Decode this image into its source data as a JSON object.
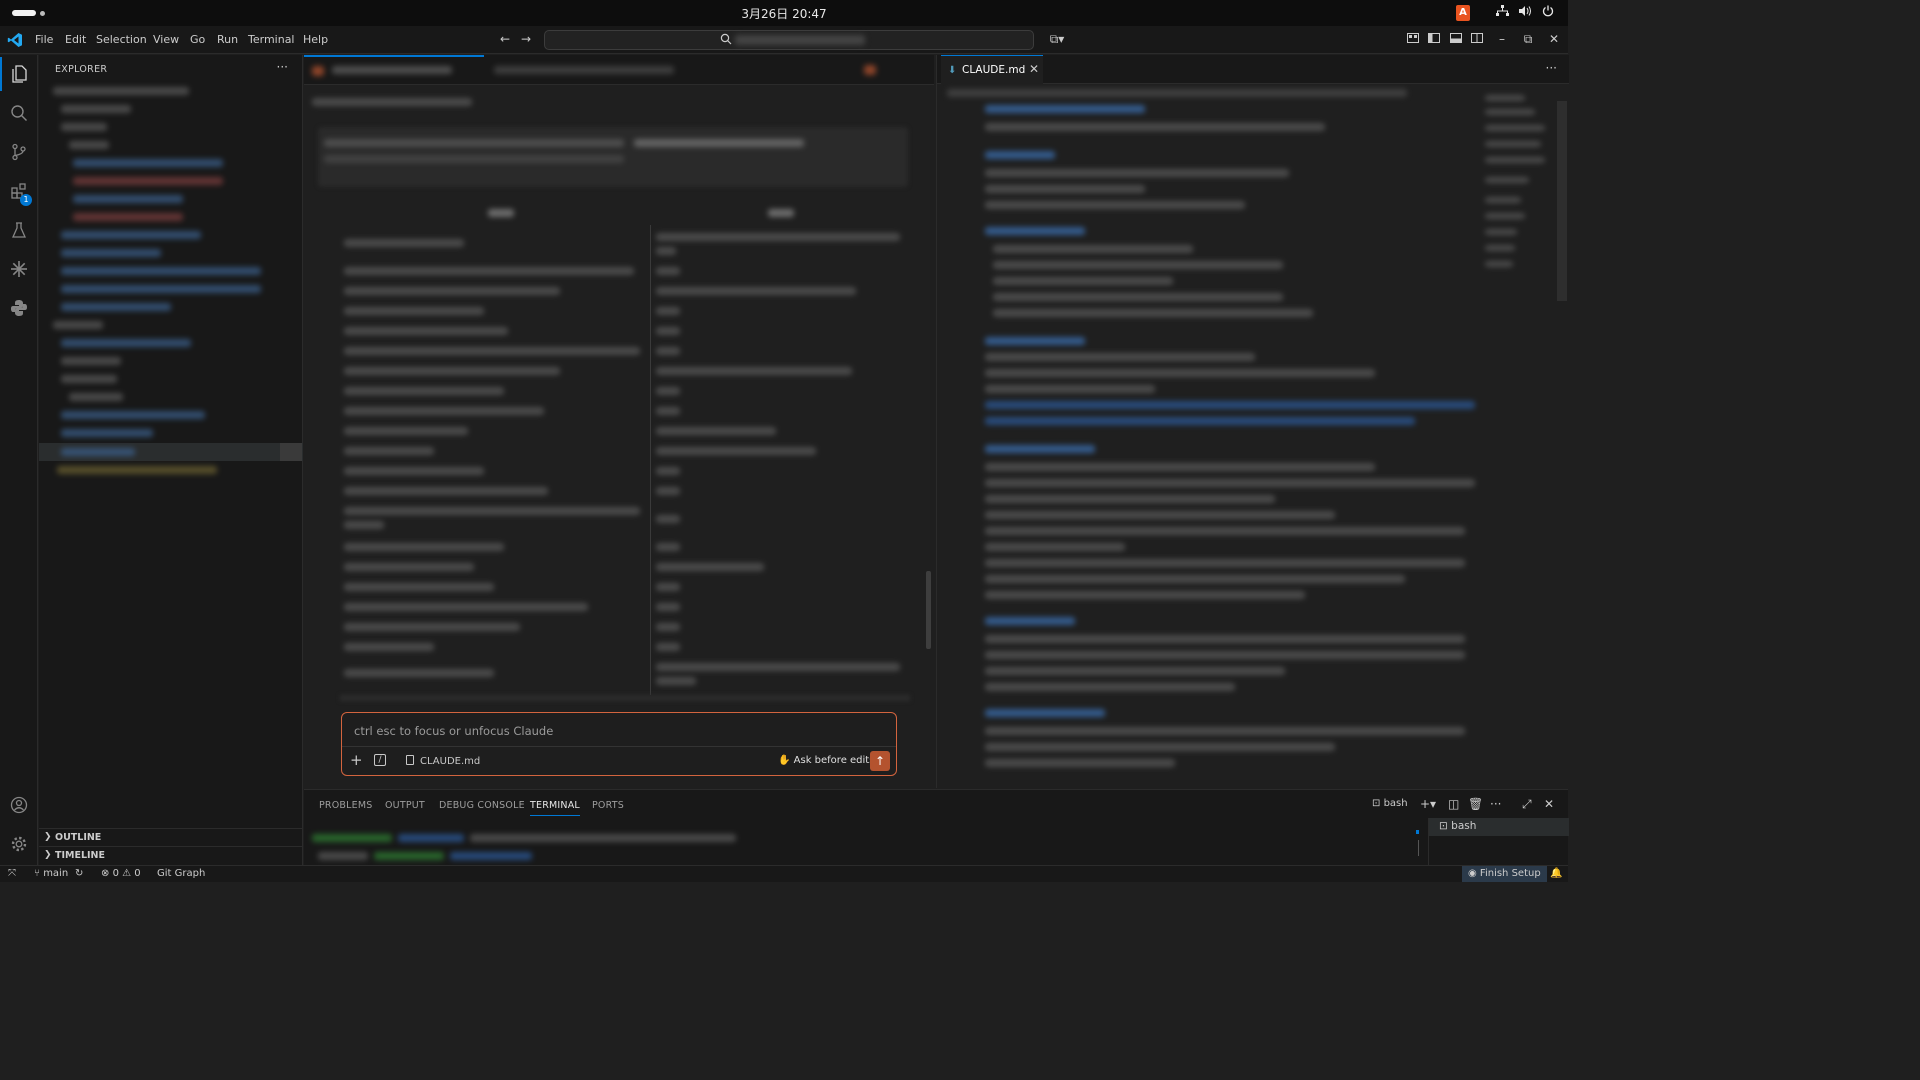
{
  "system": {
    "clock": "3月26日 20:47",
    "ime_label": "A"
  },
  "menubar": {
    "items": [
      "File",
      "Edit",
      "Selection",
      "View",
      "Go",
      "Run",
      "Terminal",
      "Help"
    ]
  },
  "sidebar": {
    "title": "EXPLORER",
    "sections": [
      "OUTLINE",
      "TIMELINE"
    ],
    "extensions_badge": "1"
  },
  "claude": {
    "input_placeholder": "ctrl esc to focus or unfocus Claude",
    "attached_file": "CLAUDE.md",
    "mode_label": "Ask before edits",
    "accent_color": "#d3643e"
  },
  "editor": {
    "tab_label": "CLAUDE.md"
  },
  "panel": {
    "tabs": [
      "PROBLEMS",
      "OUTPUT",
      "DEBUG CONSOLE",
      "TERMINAL",
      "PORTS"
    ],
    "active_tab": "TERMINAL",
    "terminal_profile": "bash",
    "terminal_instance": "bash"
  },
  "statusbar": {
    "branch": "main",
    "errors": "0",
    "warnings": "0",
    "git_graph": "Git Graph",
    "finish_setup": "Finish Setup"
  },
  "colors": {
    "accent_blue": "#0078d4",
    "claude_orange": "#d3643e",
    "background": "#1f1f1f",
    "sidebar_bg": "#181818"
  }
}
